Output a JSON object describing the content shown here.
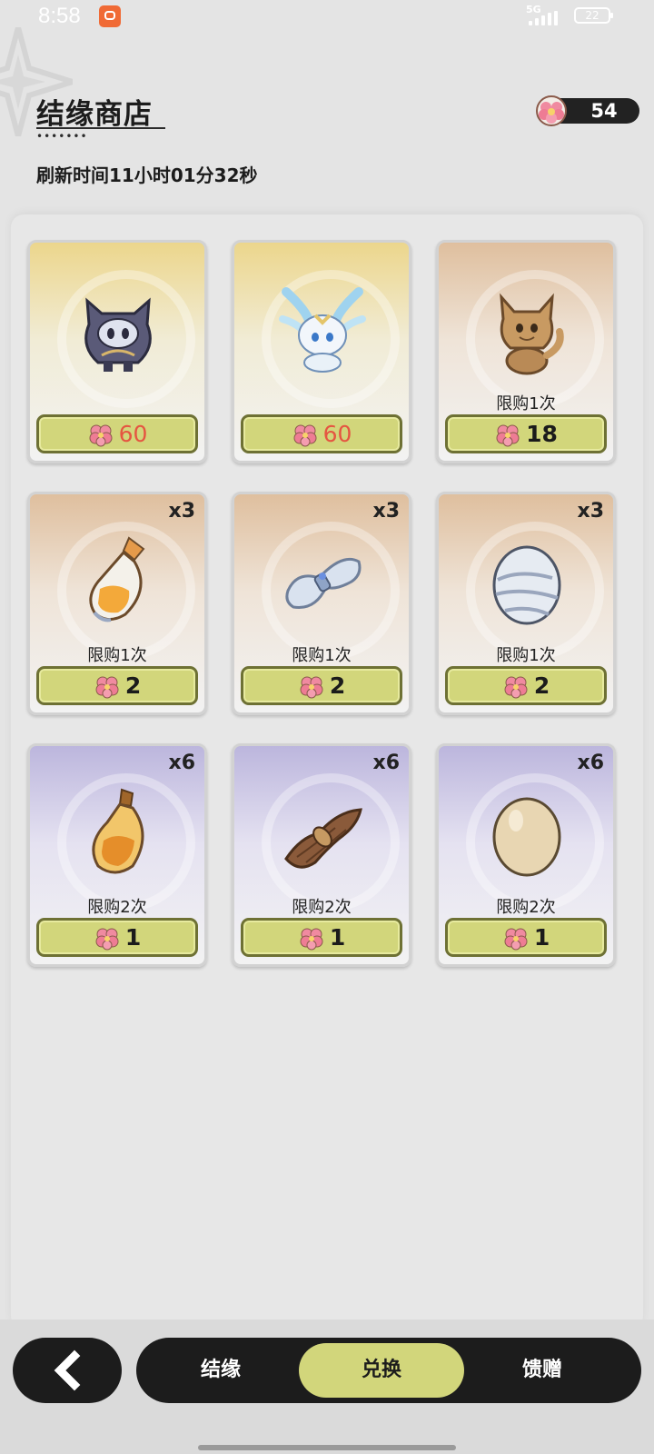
{
  "status_bar": {
    "time": "8:58",
    "network": "5G",
    "battery": "22"
  },
  "header": {
    "title": "结缘商店",
    "refresh_text": "刷新时间11小时01分32秒",
    "currency_amount": "54"
  },
  "shop_items": [
    {
      "qty": "",
      "limit": "",
      "price": "60",
      "price_unaffordable": true,
      "tier": "gold",
      "item_icon": "dark-cat-creature"
    },
    {
      "qty": "",
      "limit": "",
      "price": "60",
      "price_unaffordable": true,
      "tier": "gold",
      "item_icon": "crystal-fox-creature"
    },
    {
      "qty": "",
      "limit": "限购1次",
      "price": "18",
      "price_unaffordable": false,
      "tier": "orange",
      "item_icon": "brown-beast-creature"
    },
    {
      "qty": "x3",
      "limit": "限购1次",
      "price": "2",
      "price_unaffordable": false,
      "tier": "orange",
      "item_icon": "orange-potion-bottle"
    },
    {
      "qty": "x3",
      "limit": "限购1次",
      "price": "2",
      "price_unaffordable": false,
      "tier": "orange",
      "item_icon": "silver-cloth-bundle"
    },
    {
      "qty": "x3",
      "limit": "限购1次",
      "price": "2",
      "price_unaffordable": false,
      "tier": "orange",
      "item_icon": "silver-egg"
    },
    {
      "qty": "x6",
      "limit": "限购2次",
      "price": "1",
      "price_unaffordable": false,
      "tier": "purple",
      "item_icon": "amber-potion-bottle"
    },
    {
      "qty": "x6",
      "limit": "限购2次",
      "price": "1",
      "price_unaffordable": false,
      "tier": "purple",
      "item_icon": "brown-fiber-bundle"
    },
    {
      "qty": "x6",
      "limit": "限购2次",
      "price": "1",
      "price_unaffordable": false,
      "tier": "purple",
      "item_icon": "plain-egg"
    }
  ],
  "bottom_nav": {
    "tab_bond": "结缘",
    "tab_exchange": "兑换",
    "tab_gift": "馈赠"
  },
  "colors": {
    "accent_button": "#d2d67b",
    "price_unaffordable": "#e55541",
    "nav_bg": "#1c1c1c"
  }
}
